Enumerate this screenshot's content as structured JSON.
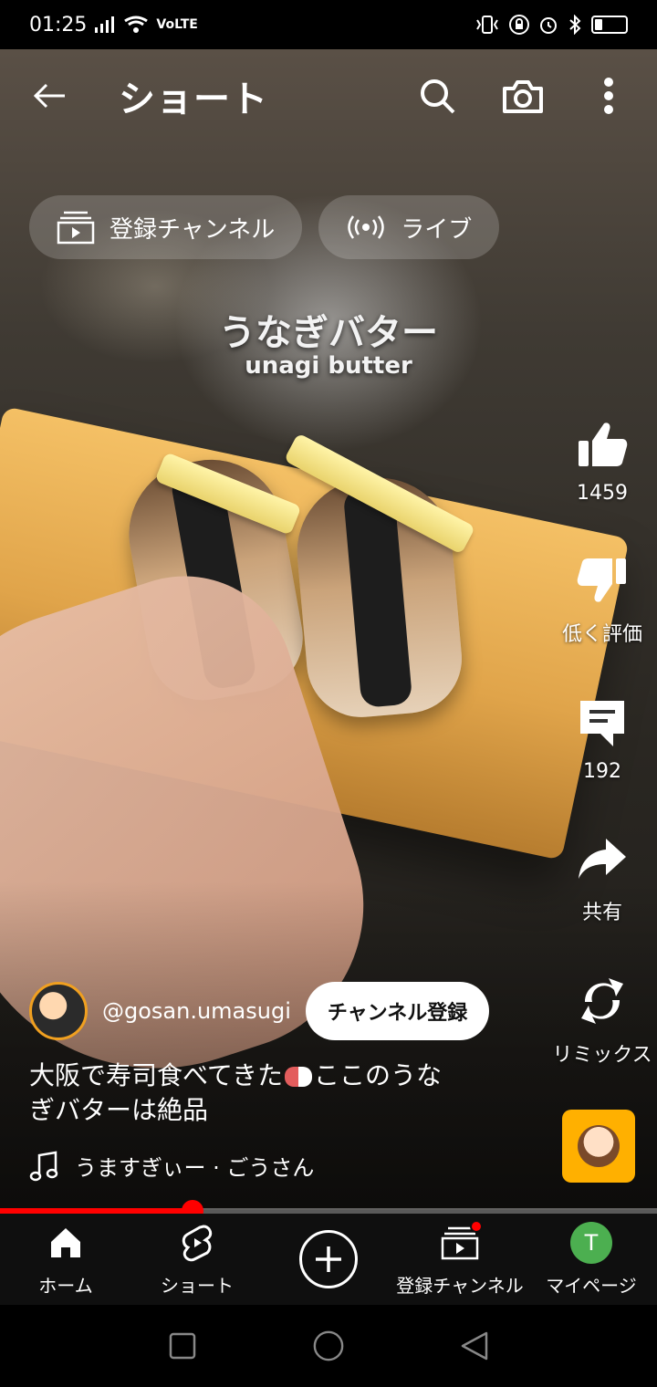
{
  "status_bar": {
    "time": "01:25",
    "network": "VoLTE",
    "icons": [
      "signal-icon",
      "wifi-icon",
      "vibrate-icon",
      "lock-icon",
      "alarm-icon",
      "bluetooth-icon",
      "battery-icon"
    ]
  },
  "header": {
    "title": "ショート"
  },
  "chips": [
    {
      "label": "登録チャンネル",
      "icon": "subscriptions-icon"
    },
    {
      "label": "ライブ",
      "icon": "live-icon"
    }
  ],
  "video": {
    "caption_jp": "うなぎバター",
    "caption_en": "unagi butter"
  },
  "actions": {
    "like": {
      "label": "1459"
    },
    "dislike": {
      "label": "低く評価"
    },
    "comments": {
      "label": "192"
    },
    "share": {
      "label": "共有"
    },
    "remix": {
      "label": "リミックス"
    }
  },
  "channel": {
    "handle": "@gosan.umasugi",
    "subscribe_label": "チャンネル登録"
  },
  "description": {
    "line1_before": "大阪で寿司食べてきた",
    "line1_after": "ここのうな",
    "line2": "ぎバターは絶品"
  },
  "music": {
    "label": "うますぎぃー · ごうさん"
  },
  "progress": {
    "fraction": 0.293
  },
  "bottom_nav": [
    {
      "label": "ホーム",
      "icon": "home-icon"
    },
    {
      "label": "ショート",
      "icon": "shorts-icon"
    },
    {
      "label": "",
      "icon": "create-icon"
    },
    {
      "label": "登録チャンネル",
      "icon": "subscriptions-icon"
    },
    {
      "label": "マイページ",
      "icon": "avatar-icon",
      "avatar_letter": "T"
    }
  ],
  "colors": {
    "accent": "#ff0000",
    "avatar_green": "#4caf50"
  }
}
